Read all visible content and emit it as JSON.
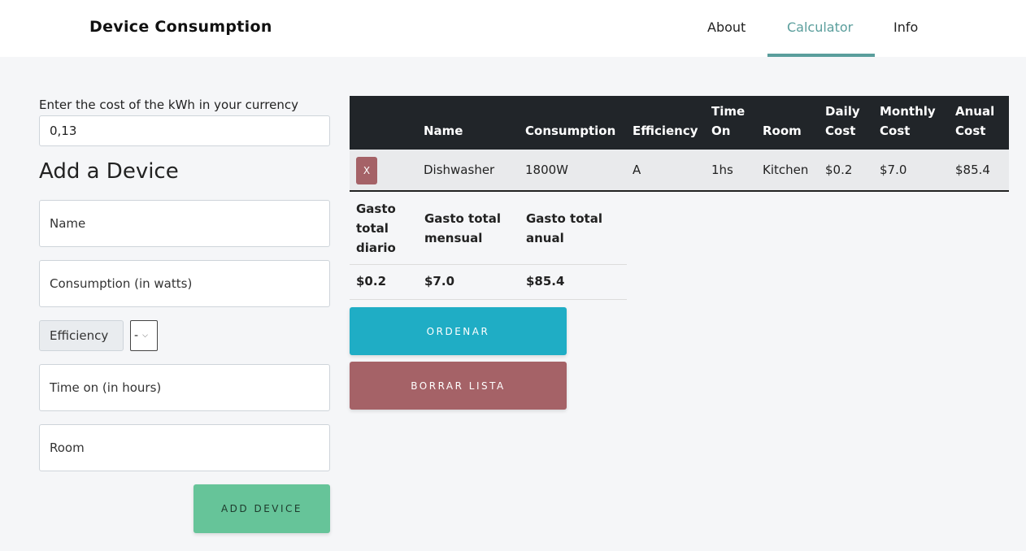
{
  "header": {
    "brand": "Device Consumption",
    "nav": {
      "about": "About",
      "calculator": "Calculator",
      "info": "Info"
    },
    "active_tab": "Calculator",
    "accent_color": "#5a9e9c"
  },
  "form": {
    "cost_label": "Enter the cost of the kWh in your currency",
    "cost_value": "0,13",
    "title": "Add a Device",
    "name_placeholder": "Name",
    "consumption_placeholder": "Consumption (in watts)",
    "efficiency_label": "Efficiency",
    "efficiency_selected": "-",
    "time_placeholder": "Time on (in hours)",
    "room_placeholder": "Room",
    "add_button": "ADD DEVICE"
  },
  "table": {
    "headers": {
      "name": "Name",
      "consumption": "Consumption",
      "efficiency": "Efficiency",
      "time_on_1": "Time",
      "time_on_2": "On",
      "room": "Room",
      "daily_1": "Daily",
      "daily_2": "Cost",
      "monthly_1": "Monthly",
      "monthly_2": "Cost",
      "annual_1": "Anual",
      "annual_2": "Cost"
    },
    "rows": [
      {
        "delete_label": "X",
        "name": "Dishwasher",
        "consumption": "1800W",
        "efficiency": "A",
        "time_on": "1hs",
        "room": "Kitchen",
        "daily": "$0.2",
        "monthly": "$7.0",
        "annual": "$85.4"
      }
    ]
  },
  "totals": {
    "daily_h1": "Gasto",
    "daily_h2": "total",
    "daily_h3": "diario",
    "monthly_h1": "Gasto total",
    "monthly_h2": "mensual",
    "annual_h1": "Gasto total",
    "annual_h2": "anual",
    "daily": "$0.2",
    "monthly": "$7.0",
    "annual": "$85.4"
  },
  "actions": {
    "order": "ORDENAR",
    "clear": "BORRAR LISTA"
  },
  "colors": {
    "order_button": "#1fadc5",
    "clear_button": "#a56267",
    "add_button": "#66c499",
    "table_header": "#212529"
  }
}
